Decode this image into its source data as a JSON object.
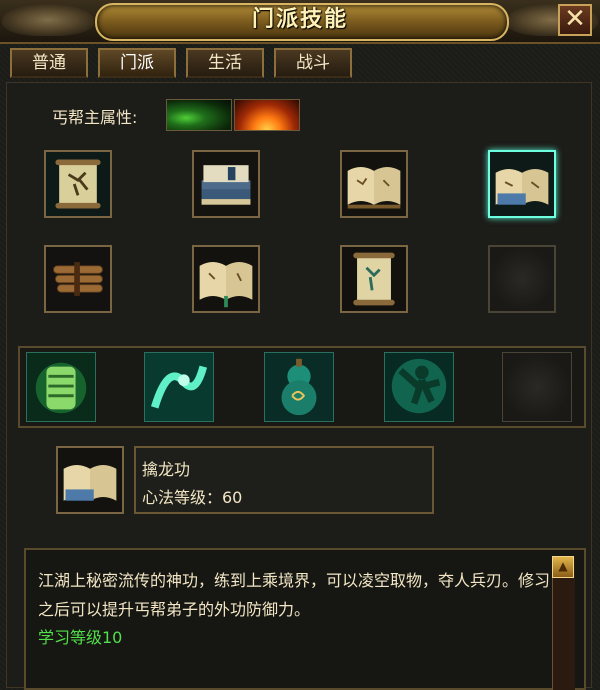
{
  "window": {
    "title": "门派技能",
    "close_label": "✕"
  },
  "tabs": [
    {
      "label": "普通",
      "active": false
    },
    {
      "label": "门派",
      "active": true
    },
    {
      "label": "生活",
      "active": false
    },
    {
      "label": "战斗",
      "active": false
    }
  ],
  "attributes": {
    "label": "丐帮主属性:",
    "icons": [
      "poison-attribute-icon",
      "fire-attribute-icon"
    ]
  },
  "skill_books": [
    {
      "icon": "scroll-martial-icon",
      "highlighted": false
    },
    {
      "icon": "book-stack-icon",
      "highlighted": false
    },
    {
      "icon": "open-book-icon",
      "highlighted": false
    },
    {
      "icon": "open-book-icon",
      "highlighted": true
    },
    {
      "icon": "bamboo-slips-icon",
      "highlighted": false
    },
    {
      "icon": "open-book-icon",
      "highlighted": false
    },
    {
      "icon": "scroll-martial-icon",
      "highlighted": false
    },
    {
      "icon": "empty-slot",
      "highlighted": false
    }
  ],
  "skills": [
    {
      "icon": "armor-shield-icon"
    },
    {
      "icon": "dragon-spirit-icon"
    },
    {
      "icon": "gourd-icon"
    },
    {
      "icon": "warrior-aura-icon"
    },
    {
      "icon": "empty-slot"
    }
  ],
  "selected_skill": {
    "icon": "open-book-icon",
    "name": "擒龙功",
    "level_text": "心法等级：60"
  },
  "description": {
    "text": "江湖上秘密流传的神功，练到上乘境界，可以凌空取物，夺人兵刃。修习之后可以提升丐帮弟子的外功防御力。",
    "learn_level": "学习等级10"
  },
  "colors": {
    "learn_level": "#52e04a",
    "highlight_border": "#6cffe0",
    "gold": "#d7b563"
  }
}
